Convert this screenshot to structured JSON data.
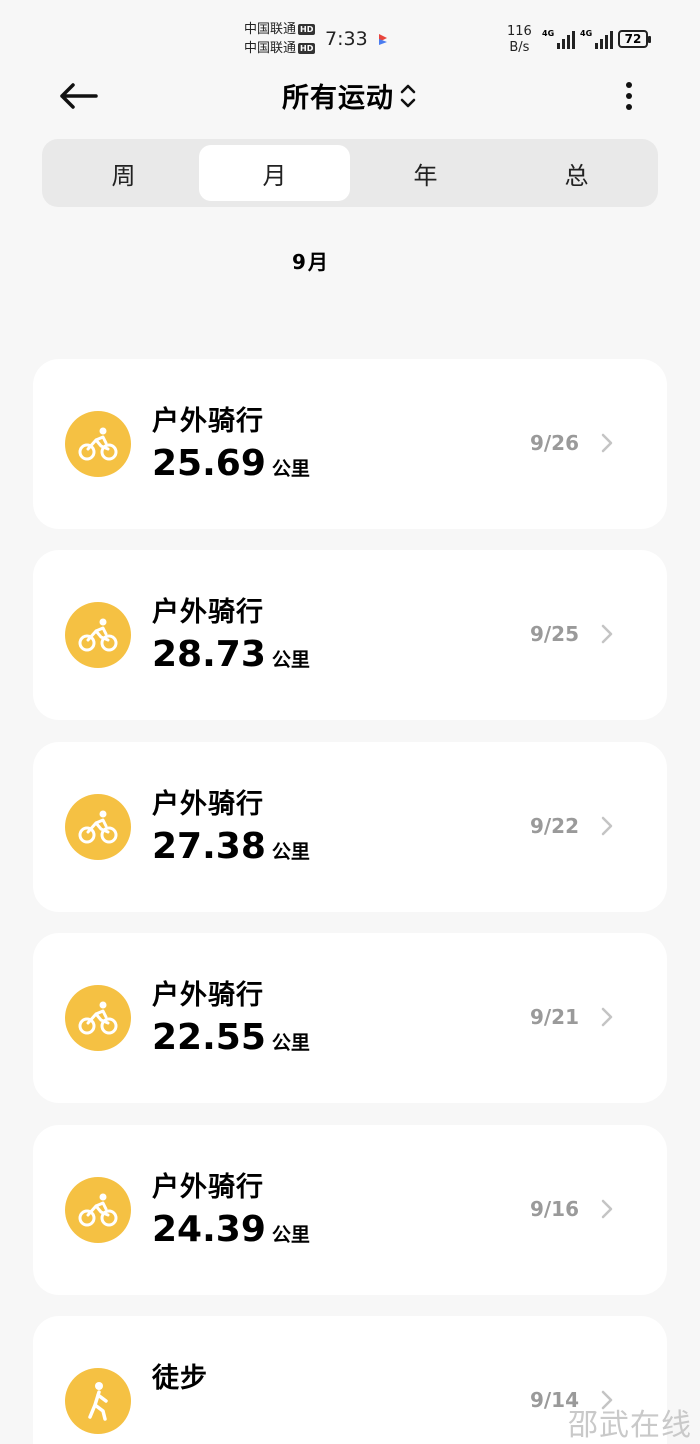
{
  "status_bar": {
    "carrier_1": "中国联通",
    "carrier_2": "中国联通",
    "hd": "HD",
    "time": "7:33",
    "speed_value": "116",
    "speed_unit": "B/s",
    "network_tag": "4G",
    "battery": "72"
  },
  "header": {
    "title": "所有运动",
    "back_icon": "arrow-left-icon",
    "more_icon": "more-vertical-icon"
  },
  "tabs": [
    {
      "label": "周",
      "active": false
    },
    {
      "label": "月",
      "active": true
    },
    {
      "label": "年",
      "active": false
    },
    {
      "label": "总",
      "active": false
    }
  ],
  "period_label": "9月",
  "activities": [
    {
      "name": "户外骑行",
      "distance": "25.69",
      "unit": "公里",
      "date": "9/26",
      "icon": "cycling-icon"
    },
    {
      "name": "户外骑行",
      "distance": "28.73",
      "unit": "公里",
      "date": "9/25",
      "icon": "cycling-icon"
    },
    {
      "name": "户外骑行",
      "distance": "27.38",
      "unit": "公里",
      "date": "9/22",
      "icon": "cycling-icon"
    },
    {
      "name": "户外骑行",
      "distance": "22.55",
      "unit": "公里",
      "date": "9/21",
      "icon": "cycling-icon"
    },
    {
      "name": "户外骑行",
      "distance": "24.39",
      "unit": "公里",
      "date": "9/16",
      "icon": "cycling-icon"
    },
    {
      "name": "徒步",
      "distance": "",
      "unit": "",
      "date": "9/14",
      "icon": "hiking-icon"
    }
  ],
  "colors": {
    "accent_icon": "#f5c143",
    "background": "#f7f7f7",
    "card": "#ffffff",
    "date_text": "#9a9a9a"
  },
  "watermark": "邵武在线"
}
